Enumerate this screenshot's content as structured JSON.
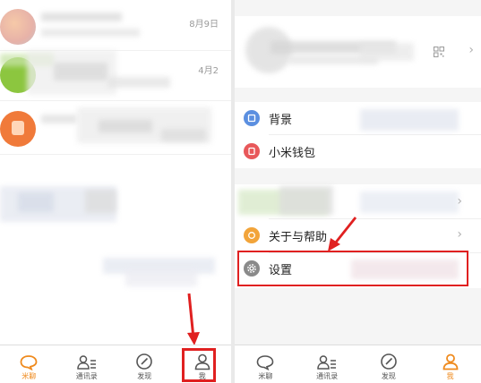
{
  "left_panel": {
    "chats": [
      {
        "date": "8月9日"
      },
      {
        "date": "4月2"
      },
      {
        "date": ""
      }
    ],
    "tabs": [
      {
        "label": "米聊",
        "icon": "chat-bubble-icon",
        "active": true
      },
      {
        "label": "通讯录",
        "icon": "contacts-icon",
        "active": false
      },
      {
        "label": "发现",
        "icon": "compass-icon",
        "active": false
      },
      {
        "label": "我",
        "icon": "person-icon",
        "active": false
      }
    ]
  },
  "right_panel": {
    "menu": {
      "background_label": "背景",
      "wallet_label": "小米钱包",
      "about_label": "关于与帮助",
      "settings_label": "设置"
    },
    "tabs": [
      {
        "label": "米聊",
        "icon": "chat-bubble-icon",
        "active": false
      },
      {
        "label": "通讯录",
        "icon": "contacts-icon",
        "active": false
      },
      {
        "label": "发现",
        "icon": "compass-icon",
        "active": false
      },
      {
        "label": "我",
        "icon": "person-icon",
        "active": true
      }
    ]
  },
  "colors": {
    "accent": "#ef8a1d",
    "annotation_red": "#e02020",
    "background_icon_blue": "#5b8fe0",
    "wallet_icon_red": "#e8585a",
    "about_icon_orange": "#f2a43a",
    "settings_icon_gray": "#8a8a8a"
  }
}
